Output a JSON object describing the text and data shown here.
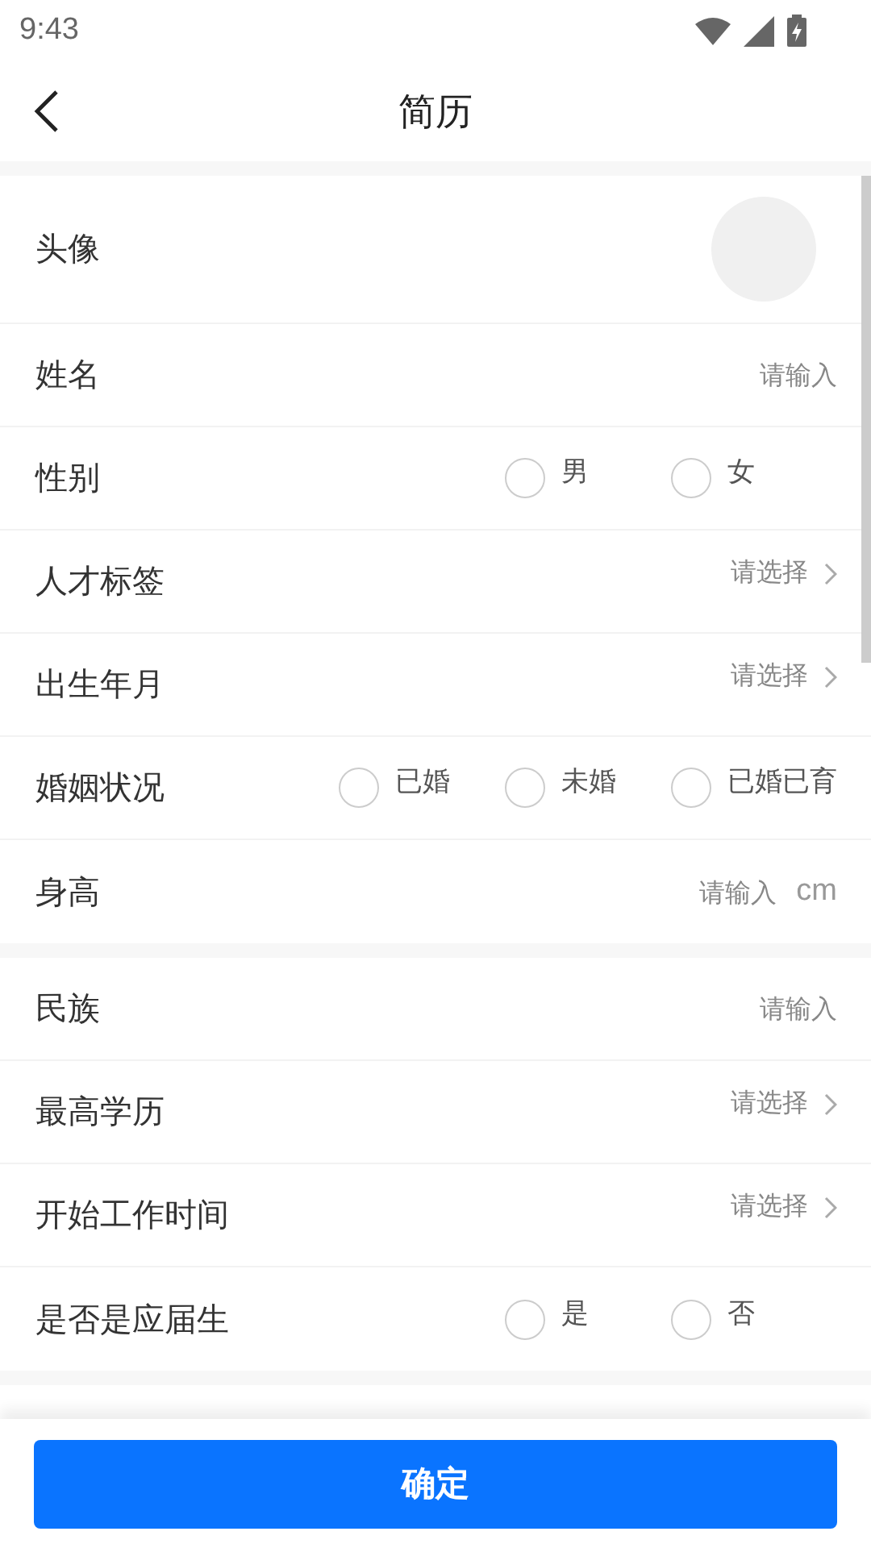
{
  "status_bar": {
    "time": "9:43"
  },
  "header": {
    "title": "简历"
  },
  "sections": [
    {
      "rows": [
        {
          "kind": "avatar",
          "label": "头像"
        },
        {
          "kind": "input",
          "label": "姓名",
          "placeholder": "请输入"
        },
        {
          "kind": "radio",
          "label": "性别",
          "options": [
            {
              "label": "男",
              "selected": false
            },
            {
              "label": "女",
              "selected": false
            }
          ]
        },
        {
          "kind": "select",
          "label": "人才标签",
          "placeholder": "请选择"
        },
        {
          "kind": "select",
          "label": "出生年月",
          "placeholder": "请选择"
        },
        {
          "kind": "radio",
          "label": "婚姻状况",
          "options": [
            {
              "label": "已婚",
              "selected": false
            },
            {
              "label": "未婚",
              "selected": false
            },
            {
              "label": "已婚已育",
              "selected": false
            }
          ]
        },
        {
          "kind": "input",
          "label": "身高",
          "placeholder": "请输入",
          "unit": "cm"
        }
      ]
    },
    {
      "rows": [
        {
          "kind": "input",
          "label": "民族",
          "placeholder": "请输入"
        },
        {
          "kind": "select",
          "label": "最高学历",
          "placeholder": "请选择"
        },
        {
          "kind": "select",
          "label": "开始工作时间",
          "placeholder": "请选择"
        },
        {
          "kind": "radio",
          "label": "是否是应届生",
          "options": [
            {
              "label": "是",
              "selected": false
            },
            {
              "label": "否",
              "selected": false
            }
          ]
        }
      ]
    }
  ],
  "footer": {
    "button": "确定"
  }
}
